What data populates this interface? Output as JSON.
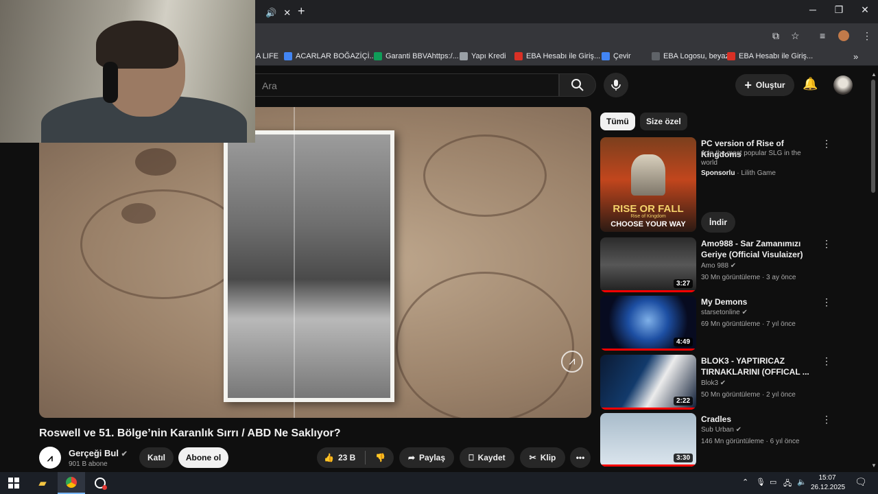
{
  "browser": {
    "tab_close": "✕",
    "new_tab": "+",
    "window_controls": {
      "minimize": "─",
      "maximize": "❐",
      "close": "✕"
    },
    "bookmarks": [
      {
        "label": "A LIFE",
        "color": "#e53935"
      },
      {
        "label": "ACARLAR BOĞAZİÇİ...",
        "color": "#4285f4"
      },
      {
        "label": "Garanti BBVAhttps:/...",
        "color": "#0f9d58"
      },
      {
        "label": "Yapı Kredi",
        "color": "#9aa0a6"
      },
      {
        "label": "EBA Hesabı ile Giriş...",
        "color": "#d93025"
      },
      {
        "label": "Çevir",
        "color": "#4285f4"
      },
      {
        "label": "EBA Logosu, beyaz...",
        "color": "#5f6368"
      },
      {
        "label": "EBA Hesabı ile Giriş...",
        "color": "#d93025"
      }
    ]
  },
  "header": {
    "search_placeholder": "Ara",
    "create_label": "Oluştur"
  },
  "video": {
    "title": "Roswell ve 51. Bölge’nin Karanlık Sırrı / ABD Ne Saklıyor?",
    "channel_name": "Gerçeği Bul",
    "subscribers": "901 B abone",
    "join_label": "Katıl",
    "subscribe_label": "Abone ol",
    "likes": "23 B",
    "share_label": "Paylaş",
    "save_label": "Kaydet",
    "clip_label": "Klip"
  },
  "sidebar": {
    "chips": [
      "Tümü",
      "Size özel"
    ],
    "ad": {
      "title": "PC version of Rise of Kingdoms",
      "description": "Join the most popular SLG in the world",
      "sponsored": "Sponsorlu",
      "advertiser": "Lilith Game",
      "install_label": "İndir",
      "thumb_line1": "RISE OR FALL",
      "thumb_line2": "Rise of Kingdom",
      "thumb_line3": "CHOOSE YOUR WAY"
    },
    "videos": [
      {
        "title": "Amo988 - Sar Zamanımızı Geriye (Official Visulaizer)",
        "channel": "Amo 988",
        "meta": "30 Mn görüntüleme · 3 ay önce",
        "duration": "3:27"
      },
      {
        "title": "My Demons",
        "channel": "starsetonline",
        "meta": "69 Mn görüntüleme · 7 yıl önce",
        "duration": "4:49"
      },
      {
        "title": "BLOK3 - YAPTIRICAZ TIRNAKLARINI (OFFICAL ...",
        "channel": "Blok3",
        "meta": "50 Mn görüntüleme · 2 yıl önce",
        "duration": "2:22"
      },
      {
        "title": "Cradles",
        "channel": "Sub Urban",
        "meta": "146 Mn görüntüleme · 6 yıl önce",
        "duration": "3:30"
      }
    ]
  },
  "taskbar": {
    "time": "15:07",
    "date": "26.12.2025"
  }
}
